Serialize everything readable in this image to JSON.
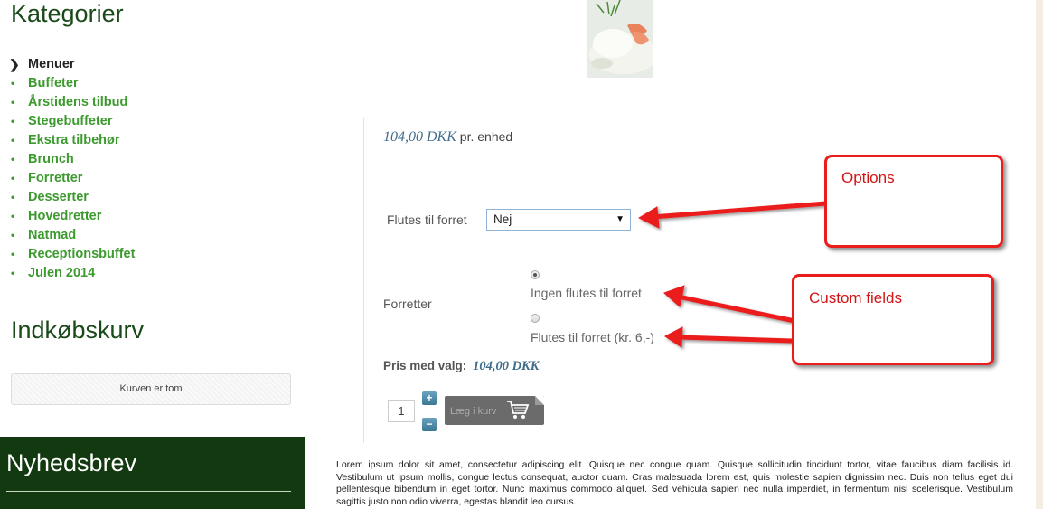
{
  "sidebar": {
    "categories_title": "Kategorier",
    "categories": [
      {
        "label": "Menuer",
        "active": true
      },
      {
        "label": "Buffeter"
      },
      {
        "label": "Årstidens tilbud"
      },
      {
        "label": "Stegebuffeter"
      },
      {
        "label": "Ekstra tilbehør"
      },
      {
        "label": "Brunch"
      },
      {
        "label": "Forretter"
      },
      {
        "label": "Desserter"
      },
      {
        "label": "Hovedretter"
      },
      {
        "label": "Natmad"
      },
      {
        "label": "Receptionsbuffet"
      },
      {
        "label": "Julen 2014"
      }
    ],
    "cart_title": "Indkøbskurv",
    "cart_empty": "Kurven er tom",
    "newsletter_title": "Nyhedsbrev"
  },
  "product": {
    "price": "104,00 DKK",
    "price_unit": "pr. enhed",
    "option_label": "Flutes til forret",
    "option_value": "Nej",
    "custom_label": "Forretter",
    "radio_options": [
      "Ingen flutes til forret",
      "Flutes til forret (kr. 6,-)"
    ],
    "radio_selected": 0,
    "price_with_options_label": "Pris med valg:",
    "price_with_options": "104,00 DKK",
    "quantity": "1",
    "qty_plus": "+",
    "qty_minus": "−",
    "add_to_cart": "Læg i kurv",
    "description": "Lorem ipsum dolor sit amet, consectetur adipiscing elit. Quisque nec congue quam. Quisque sollicitudin tincidunt tortor, vitae faucibus diam facilisis id. Vestibulum ut ipsum mollis, congue lectus consequat, auctor quam. Cras malesuada lorem est, quis molestie sapien dignissim nec. Duis non tellus eget dui pellentesque bibendum in eget tortor. Nunc maximus commodo aliquet. Sed vehicula sapien nec nulla imperdiet, in fermentum nisl scelerisque. Vestibulum sagittis justo non odio viverra, egestas blandit leo cursus."
  },
  "annotations": {
    "options": "Options",
    "custom_fields": "Custom fields"
  },
  "colors": {
    "accent_green": "#3c9a2e",
    "dark_green": "#12390f",
    "annotation_red": "#ea1c1c",
    "price_blue": "#3f6c8a"
  },
  "icons": [
    "chevron-right-icon",
    "cart-icon",
    "dropdown-arrow-icon"
  ]
}
